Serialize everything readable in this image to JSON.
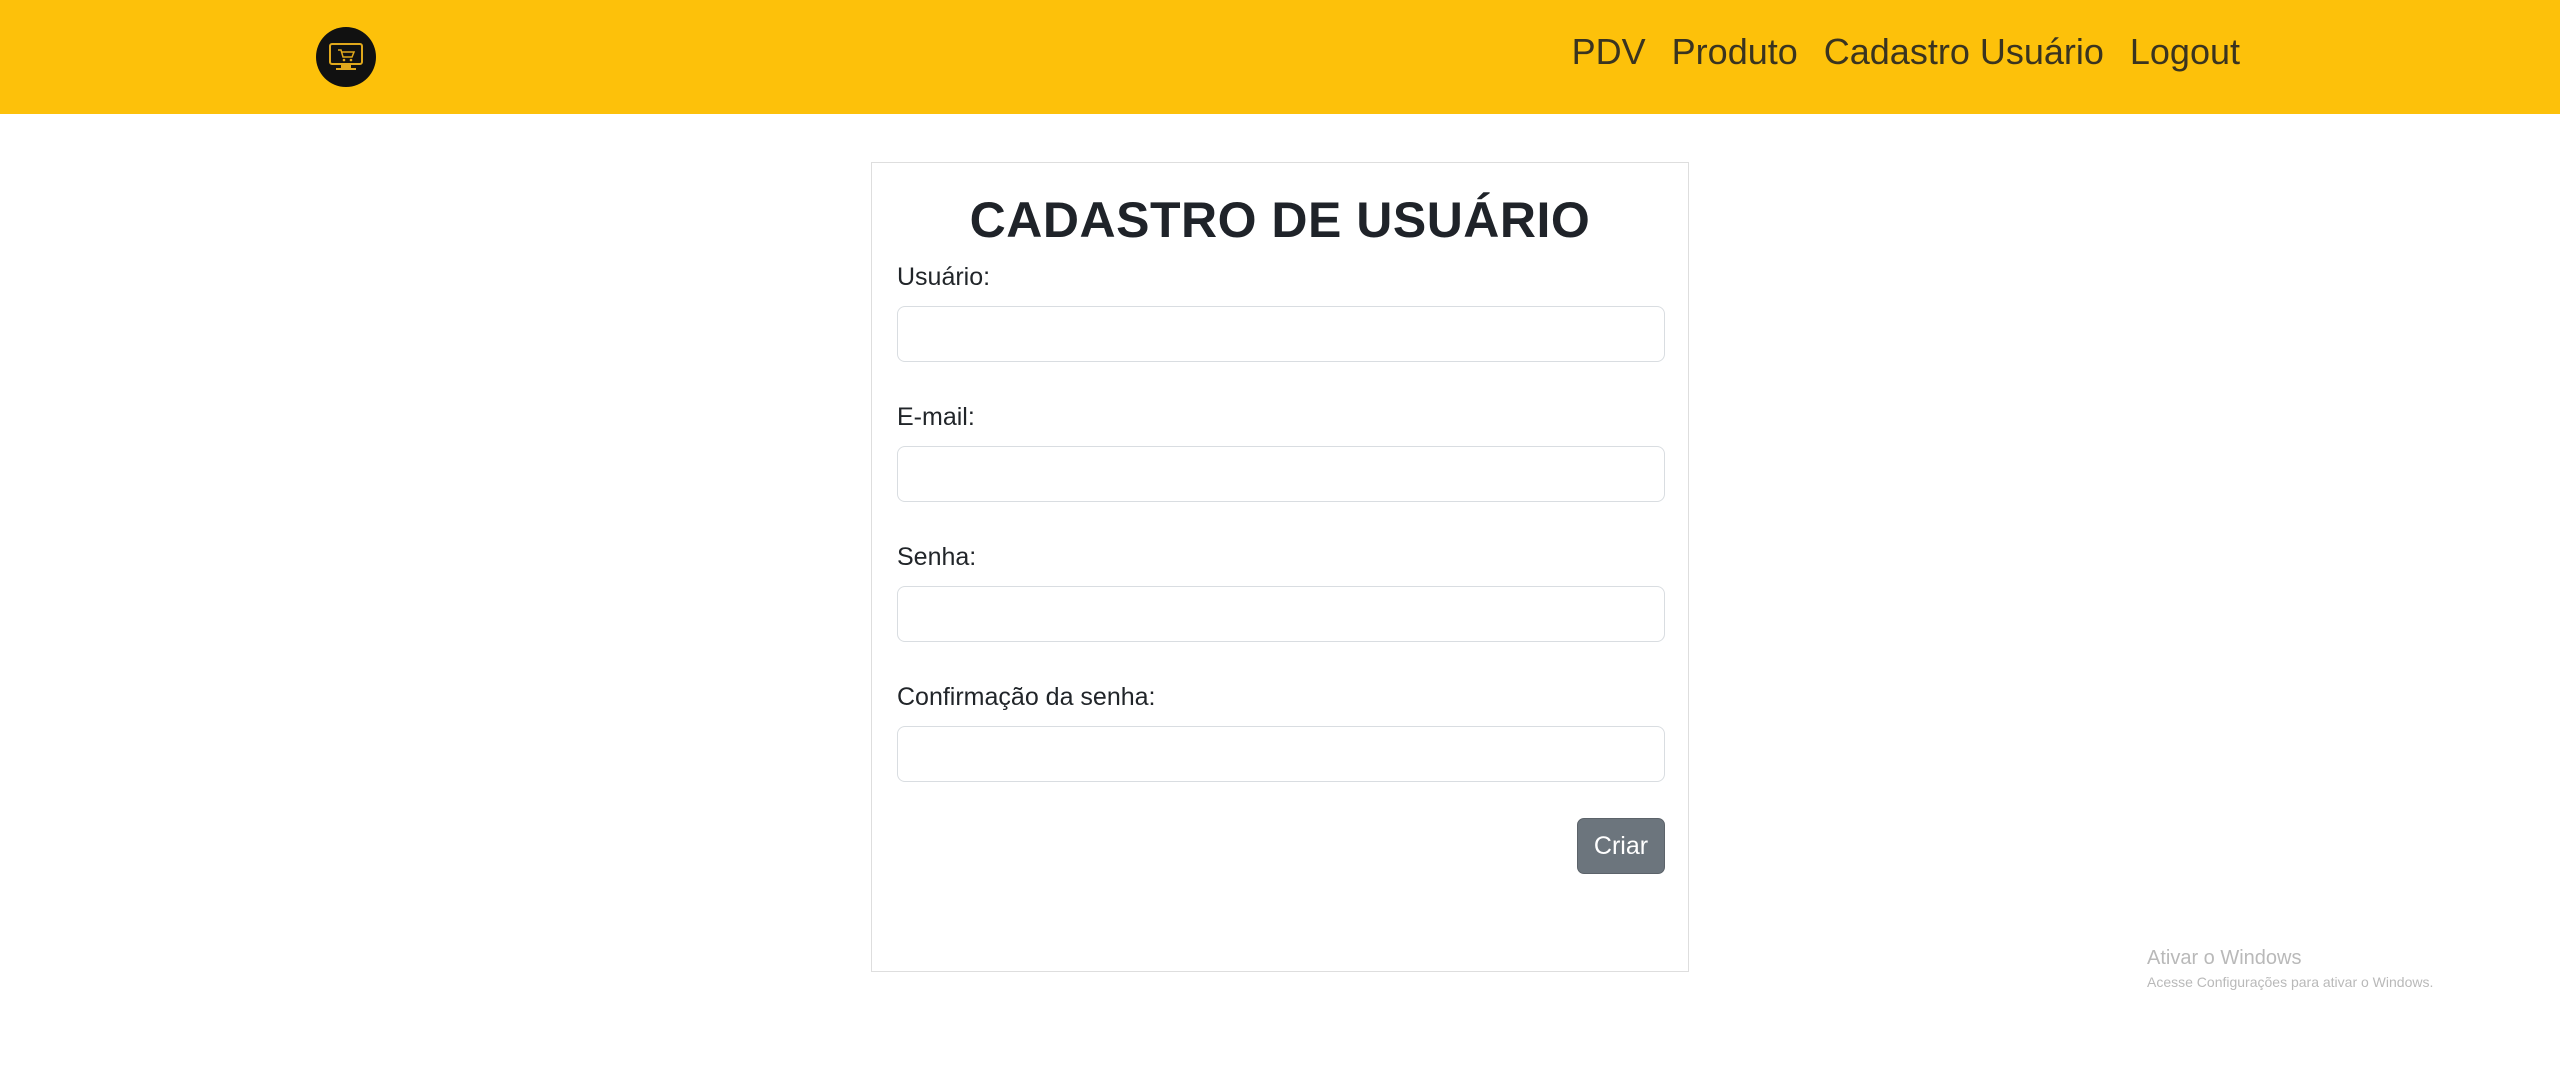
{
  "colors": {
    "navbar_bg": "#fdc10a",
    "button_bg": "#6c757d",
    "text": "#212529"
  },
  "navbar": {
    "logo_icon": "monitor-cart-logo-icon",
    "links": [
      "PDV",
      "Produto",
      "Cadastro Usuário",
      "Logout"
    ]
  },
  "form": {
    "title": "CADASTRO DE USUÁRIO",
    "fields": [
      {
        "label": "Usuário:",
        "value": "",
        "placeholder": ""
      },
      {
        "label": "E-mail:",
        "value": "",
        "placeholder": ""
      },
      {
        "label": "Senha:",
        "value": "",
        "placeholder": ""
      },
      {
        "label": "Confirmação da senha:",
        "value": "",
        "placeholder": ""
      }
    ],
    "submit_label": "Criar"
  },
  "watermark": {
    "title": "Ativar o Windows",
    "subtitle": "Acesse Configurações para ativar o Windows."
  }
}
